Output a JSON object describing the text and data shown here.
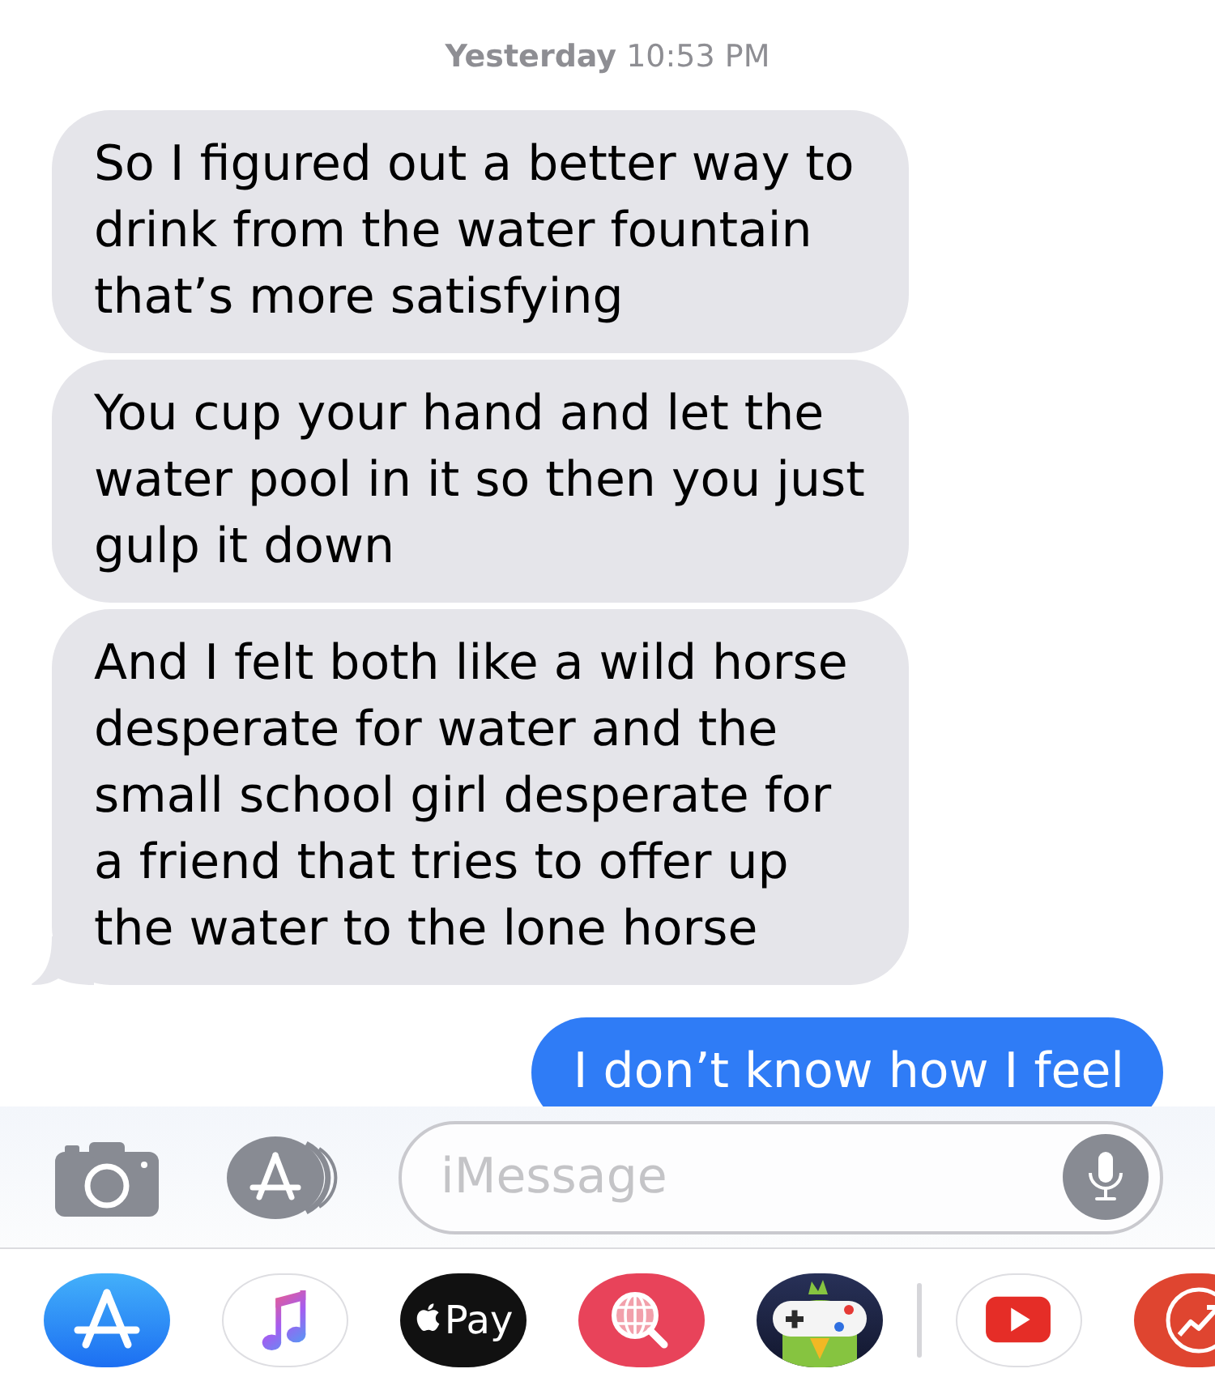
{
  "timestamp": "**Yesterday** 10:53 PM",
  "messages": [
    {
      "kind": "received",
      "text": "So I figured out a better way to drink from the water fountain that’s more satisfying",
      "tail": false
    },
    {
      "kind": "received",
      "text": "You cup your hand and let the water pool in it so then you just gulp it down",
      "tail": false
    },
    {
      "kind": "received",
      "text": "And I felt both like a wild horse desperate for water and the small school girl desperate for a friend that tries to offer up the water to the lone horse",
      "tail": true
    },
    {
      "kind": "sent",
      "text": "I don’t know how I feel",
      "tail": false
    }
  ],
  "composer": {
    "placeholder": "iMessage"
  },
  "app_drawer": [
    {
      "kind": "app-store"
    },
    {
      "kind": "music"
    },
    {
      "kind": "pay",
      "label": "Pay"
    },
    {
      "kind": "web-search"
    },
    {
      "kind": "game"
    },
    {
      "kind": "divider"
    },
    {
      "kind": "video"
    },
    {
      "kind": "trending"
    }
  ]
}
